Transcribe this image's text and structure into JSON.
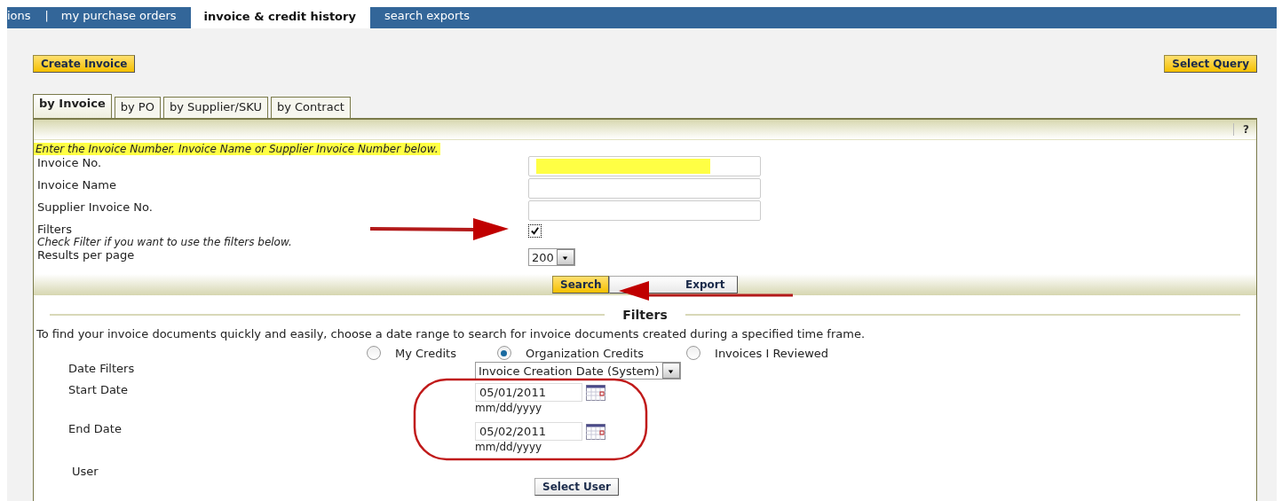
{
  "nav_tabs": [
    {
      "kind": "tab",
      "label": "ions",
      "selected": false
    },
    {
      "kind": "separator",
      "label": "|"
    },
    {
      "kind": "tab",
      "label": "my purchase orders",
      "selected": false
    },
    {
      "kind": "tab",
      "label": "invoice & credit history",
      "selected": true
    },
    {
      "kind": "tab",
      "label": "search exports",
      "selected": false
    }
  ],
  "toolbar": {
    "create_button": "Create Invoice",
    "query_button": "Select Query"
  },
  "search_tabs": [
    {
      "label": "by Invoice",
      "selected": true
    },
    {
      "label": "by PO",
      "selected": false
    },
    {
      "label": "by Supplier/SKU",
      "selected": false
    },
    {
      "label": "by Contract",
      "selected": false
    }
  ],
  "help_button": "?",
  "instruction": "Enter the Invoice Number, Invoice Name or Supplier Invoice Number below.",
  "fields": [
    {
      "kind": "text",
      "label": "Invoice No."
    },
    {
      "kind": "text",
      "label": "Invoice Name"
    },
    {
      "kind": "text",
      "label": "Supplier Invoice No."
    },
    {
      "kind": "checkbox",
      "label": "Filters",
      "hint": "Check Filter if you want to use the filters below.",
      "checked": true
    },
    {
      "kind": "select",
      "label": "Results per page",
      "value": "200"
    }
  ],
  "actions": {
    "search": "Search",
    "export": "Export"
  },
  "filters": {
    "title": "Filters",
    "description": "To find your invoice documents quickly and easily, choose a date range to search for invoice documents created during a specified time frame.",
    "scope": [
      {
        "label": "My Credits",
        "selected": false
      },
      {
        "label": "Organization Credits",
        "selected": true
      },
      {
        "label": "Invoices I Reviewed",
        "selected": false
      }
    ],
    "date_filter": {
      "label": "Date Filters",
      "value": "Invoice Creation Date (System)"
    },
    "dates": [
      {
        "label": "Start Date",
        "value": "05/01/2011",
        "format": "mm/dd/yyyy"
      },
      {
        "label": "End Date",
        "value": "05/02/2011",
        "format": "mm/dd/yyyy"
      }
    ],
    "user": {
      "label": "User",
      "button": "Select User"
    }
  }
}
